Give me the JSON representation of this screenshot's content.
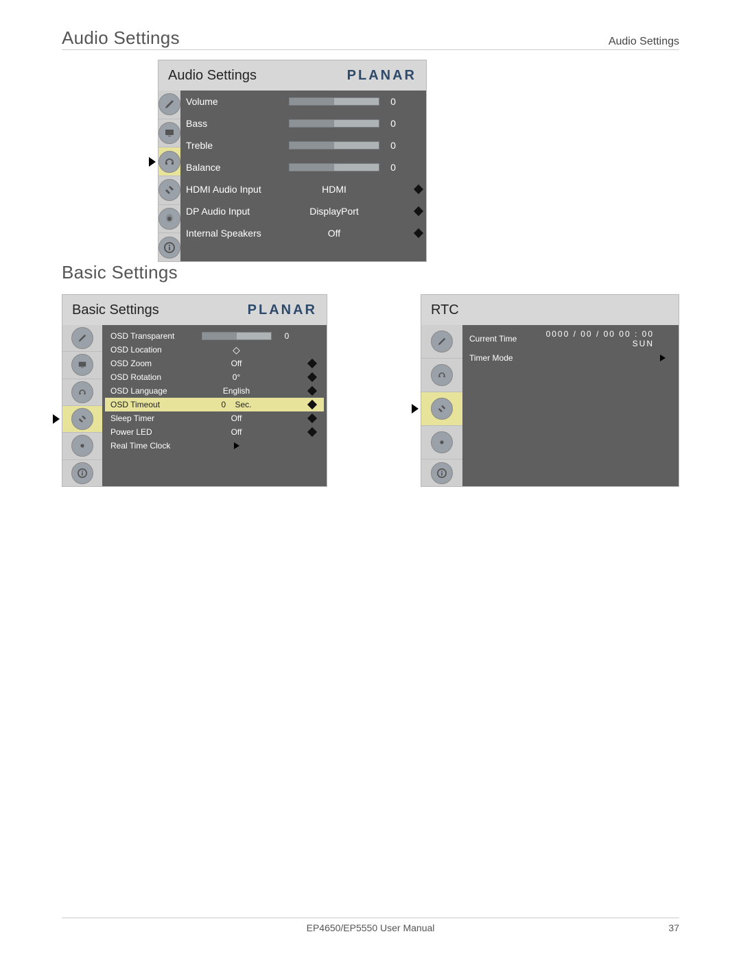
{
  "header": {
    "running": "Audio Settings"
  },
  "sections": {
    "audio_title": "Audio Settings",
    "basic_title": "Basic Settings"
  },
  "brand": "PLANAR",
  "audio_panel": {
    "title": "Audio Settings",
    "rows": {
      "volume": {
        "label": "Volume",
        "value": "0"
      },
      "bass": {
        "label": "Bass",
        "value": "0"
      },
      "treble": {
        "label": "Treble",
        "value": "0"
      },
      "balance": {
        "label": "Balance",
        "value": "0"
      },
      "hdmi": {
        "label": "HDMI Audio Input",
        "value": "HDMI"
      },
      "dp": {
        "label": "DP Audio Input",
        "value": "DisplayPort"
      },
      "spk": {
        "label": "Internal Speakers",
        "value": "Off"
      }
    }
  },
  "basic_panel": {
    "title": "Basic Settings",
    "rows": {
      "transparent": {
        "label": "OSD Transparent",
        "value": "0"
      },
      "location": {
        "label": "OSD Location"
      },
      "zoom": {
        "label": "OSD Zoom",
        "value": "Off"
      },
      "rotation": {
        "label": "OSD Rotation",
        "value": "0°"
      },
      "language": {
        "label": "OSD Language",
        "value": "English"
      },
      "timeout": {
        "label": "OSD Timeout",
        "num": "0",
        "unit": "Sec."
      },
      "sleep": {
        "label": "Sleep Timer",
        "value": "Off"
      },
      "led": {
        "label": "Power LED",
        "value": "Off"
      },
      "rtc": {
        "label": "Real Time Clock"
      }
    }
  },
  "rtc_panel": {
    "title": "RTC",
    "current_time_label": "Current Time",
    "current_time_value": "0000 / 00 / 00    00 : 00   SUN",
    "timer_mode_label": "Timer Mode"
  },
  "footer": {
    "center": "EP4650/EP5550 User Manual",
    "page": "37"
  }
}
